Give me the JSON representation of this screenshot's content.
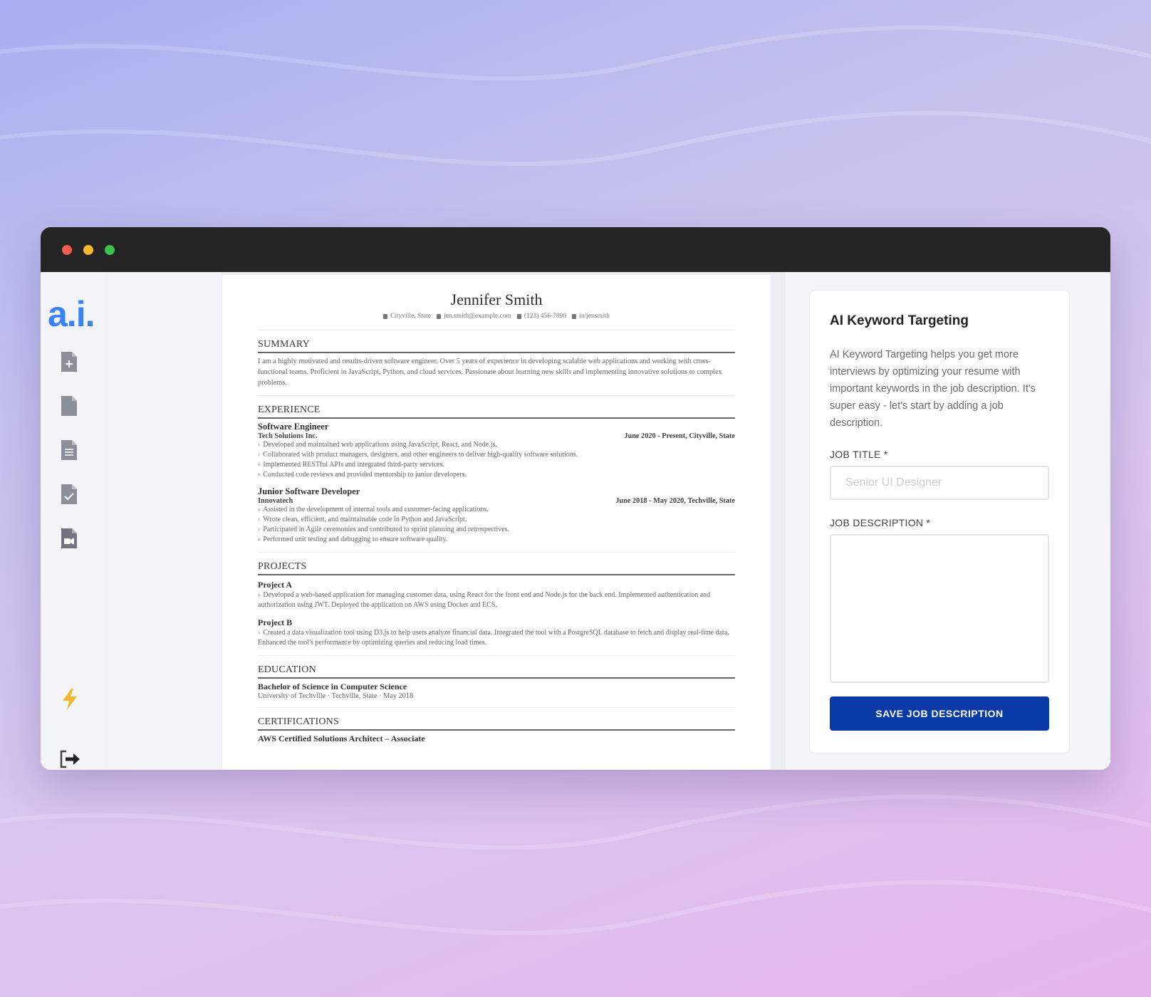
{
  "app": {
    "logo_text": "a.i."
  },
  "sidebar": {
    "items": [
      {
        "icon": "file-plus-icon"
      },
      {
        "icon": "file-icon"
      },
      {
        "icon": "file-text-icon"
      },
      {
        "icon": "file-check-icon"
      },
      {
        "icon": "file-video-icon"
      }
    ],
    "boost_icon": "bolt-icon",
    "logout_icon": "logout-icon"
  },
  "resume": {
    "name": "Jennifer Smith",
    "contact": {
      "location": "Cityville, State",
      "email": "jen.smith@example.com",
      "phone": "(123) 456-7890",
      "linkedin": "in/jensmith"
    },
    "summary": {
      "title": "SUMMARY",
      "text": "I am a highly motivated and results-driven software engineer. Over 5 years of experience in developing scalable web applications and working with cross-functional teams. Proficient in JavaScript, Python, and cloud services. Passionate about learning new skills and implementing innovative solutions to complex problems."
    },
    "experience": {
      "title": "EXPERIENCE",
      "jobs": [
        {
          "role": "Software Engineer",
          "company": "Tech Solutions Inc.",
          "dates": "June 2020 - Present,",
          "location": "Cityville, State",
          "bullets": [
            "Developed and maintained web applications using JavaScript, React, and Node.js.",
            "Collaborated with product managers, designers, and other engineers to deliver high-quality software solutions.",
            "Implemented RESTful APIs and integrated third-party services.",
            "Conducted code reviews and provided mentorship to junior developers."
          ]
        },
        {
          "role": "Junior Software Developer",
          "company": "Innovatech",
          "dates": "June 2018 - May 2020,",
          "location": "Techville, State",
          "bullets": [
            "Assisted in the development of internal tools and customer-facing applications.",
            "Wrote clean, efficient, and maintainable code in Python and JavaScript.",
            "Participated in Agile ceremonies and contributed to sprint planning and retrospectives.",
            "Performed unit testing and debugging to ensure software quality."
          ]
        }
      ]
    },
    "projects": {
      "title": "PROJECTS",
      "items": [
        {
          "name": "Project A",
          "text": "Developed a web-based application for managing customer data, using React for the front end and Node.js for the back end. Implemented authentication and authorization using JWT. Deployed the application on AWS using Docker and ECS."
        },
        {
          "name": "Project B",
          "text": "Created a data visualization tool using D3.js to help users analyze financial data. Integrated the tool with a PostgreSQL database to fetch and display real-time data. Enhanced the tool's performance by optimizing queries and reducing load times."
        }
      ]
    },
    "education": {
      "title": "EDUCATION",
      "degree": "Bachelor of Science in Computer Science",
      "school": "University of Techville",
      "location": "Techville, State",
      "date": "May 2018"
    },
    "certifications": {
      "title": "CERTIFICATIONS",
      "items": [
        "AWS Certified Solutions Architect – Associate"
      ]
    }
  },
  "panel": {
    "title": "AI Keyword Targeting",
    "description": "AI Keyword Targeting helps you get more interviews by optimizing your resume with important keywords in the job description. It's super easy - let's start by adding a job description.",
    "job_title_label": "JOB TITLE *",
    "job_title_placeholder": "Senior UI Designer",
    "job_title_value": "",
    "job_description_label": "JOB DESCRIPTION *",
    "job_description_value": "",
    "save_button": "SAVE JOB DESCRIPTION"
  },
  "colors": {
    "accent": "#0a3aa8",
    "logo": "#3b82f6",
    "bolt": "#f5b82e"
  }
}
